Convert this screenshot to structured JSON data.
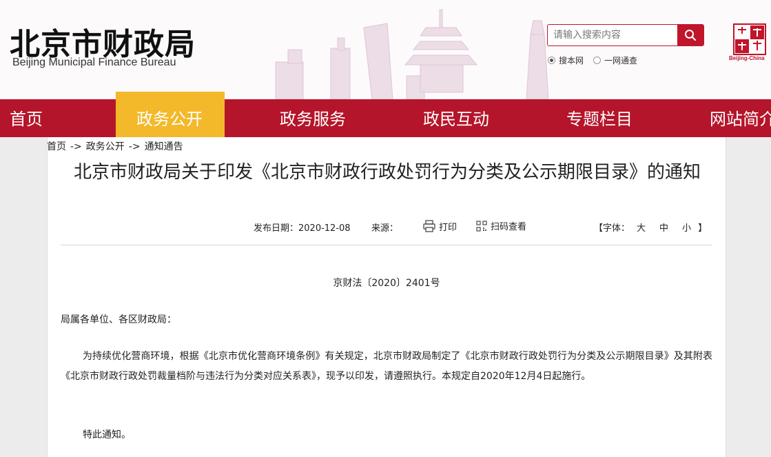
{
  "header": {
    "logo_cn": "北京市财政局",
    "logo_en": "Beijing Municipal Finance Bureau",
    "search": {
      "placeholder": "请输入搜索内容"
    },
    "search_scope": [
      {
        "label": "搜本网",
        "checked": true
      },
      {
        "label": "一网通查",
        "checked": false
      }
    ],
    "seal_text": "Beijing-China"
  },
  "nav": {
    "items": [
      {
        "label": "首页",
        "active": false
      },
      {
        "label": "政务公开",
        "active": true
      },
      {
        "label": "政务服务",
        "active": false
      },
      {
        "label": "政民互动",
        "active": false
      },
      {
        "label": "专题栏目",
        "active": false
      },
      {
        "label": "网站简介",
        "active": false
      }
    ],
    "active_color": "#f3b92a",
    "bar_color": "#b5152b"
  },
  "breadcrumb": {
    "items": [
      "首页",
      "政务公开",
      "通知通告"
    ],
    "separator": "->"
  },
  "article": {
    "title": "北京市财政局关于印发《北京市财政行政处罚行为分类及公示期限目录》的通知",
    "meta": {
      "date_label": "发布日期：",
      "date": "2020-12-08",
      "source_label": "来源：",
      "print_label": "打印",
      "qr_label": "扫码查看",
      "font_label": "【字体：",
      "font_sizes": [
        "大",
        "中",
        "小"
      ],
      "font_close": "】"
    },
    "doc_number": "京财法〔2020〕2401号",
    "salutation": "局属各单位、各区财政局：",
    "body": "为持续优化营商环境，根据《北京市优化营商环境条例》有关规定，北京市财政局制定了《北京市财政行政处罚行为分类及公示期限目录》及其附表《北京市财政行政处罚裁量档阶与违法行为分类对应关系表》，现予以印发，请遵照执行。本规定自2020年12月4日起施行。",
    "closing": "特此通知。"
  }
}
